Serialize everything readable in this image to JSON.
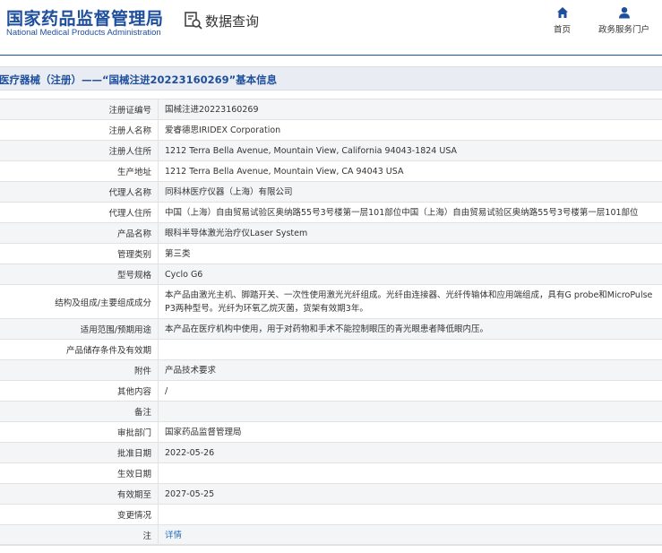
{
  "header": {
    "logo_cn": "国家药品监督管理局",
    "logo_en": "National Medical Products Administration",
    "data_query_label": "数据查询",
    "nav_home": "首页",
    "nav_service": "政务服务门户"
  },
  "page": {
    "title": "医疗器械（注册）——“国械注进20223160269”基本信息"
  },
  "colors": {
    "brand": "#1e4f9c",
    "link": "#2a6ebb"
  },
  "rows": [
    {
      "label": "注册证编号",
      "value": "国械注进20223160269"
    },
    {
      "label": "注册人名称",
      "value": "爱睿德思IRIDEX Corporation"
    },
    {
      "label": "注册人住所",
      "value": "1212 Terra Bella Avenue, Mountain View, California 94043-1824 USA"
    },
    {
      "label": "生产地址",
      "value": "1212 Terra Bella Avenue, Mountain View, CA 94043 USA"
    },
    {
      "label": "代理人名称",
      "value": "同科林医疗仪器（上海）有限公司"
    },
    {
      "label": "代理人住所",
      "value": "中国（上海）自由贸易试验区奥纳路55号3号楼第一层101部位中国（上海）自由贸易试验区奥纳路55号3号楼第一层101部位"
    },
    {
      "label": "产品名称",
      "value": "眼科半导体激光治疗仪Laser System"
    },
    {
      "label": "管理类别",
      "value": "第三类"
    },
    {
      "label": "型号规格",
      "value": "Cyclo G6"
    },
    {
      "label": "结构及组成/主要组成成分",
      "value": "本产品由激光主机、脚踏开关、一次性使用激光光纤组成。光纤由连接器、光纤传输体和应用端组成，具有G probe和MicroPulse P3两种型号。光纤为环氧乙烷灭菌，货架有效期3年。"
    },
    {
      "label": "适用范围/预期用途",
      "value": "本产品在医疗机构中使用，用于对药物和手术不能控制眼压的青光眼患者降低眼内压。"
    },
    {
      "label": "产品储存条件及有效期",
      "value": ""
    },
    {
      "label": "附件",
      "value": "产品技术要求"
    },
    {
      "label": "其他内容",
      "value": "/"
    },
    {
      "label": "备注",
      "value": ""
    },
    {
      "label": "审批部门",
      "value": "国家药品监督管理局"
    },
    {
      "label": "批准日期",
      "value": "2022-05-26"
    },
    {
      "label": "生效日期",
      "value": ""
    },
    {
      "label": "有效期至",
      "value": "2027-05-25"
    },
    {
      "label": "变更情况",
      "value": ""
    },
    {
      "label": "注",
      "value": "详情",
      "link": true
    }
  ]
}
